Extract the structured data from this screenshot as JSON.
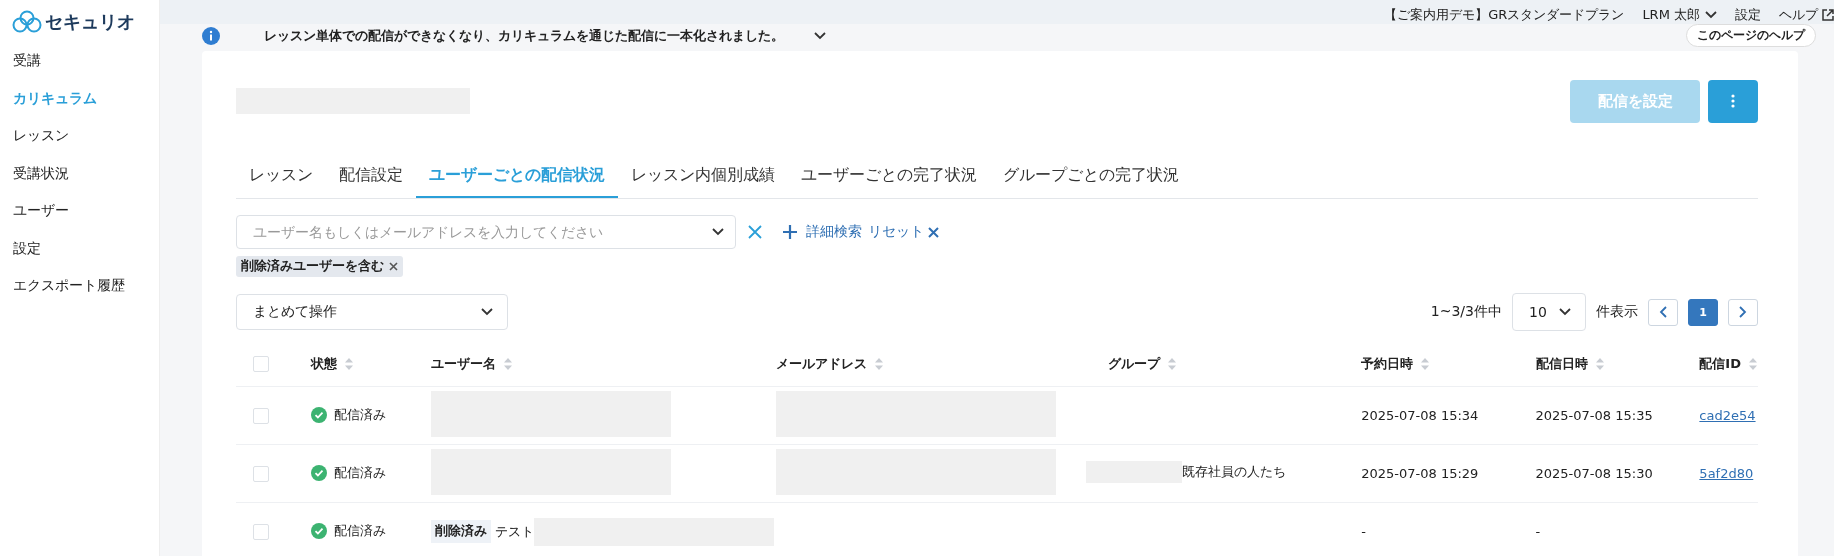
{
  "sidebar": {
    "logo": "セキュリオ",
    "items": [
      {
        "label": "受講",
        "selected": false
      },
      {
        "label": "カリキュラム",
        "selected": true
      },
      {
        "label": "レッスン",
        "selected": false
      },
      {
        "label": "受講状況",
        "selected": false
      },
      {
        "label": "ユーザー",
        "selected": false
      },
      {
        "label": "設定",
        "selected": false
      },
      {
        "label": "エクスポート履歴",
        "selected": false
      }
    ]
  },
  "top_bar": {
    "plan": "【ご案内用デモ】GRスタンダードプラン",
    "user": "LRM 太郎",
    "links": [
      "設定",
      "ヘルプ"
    ]
  },
  "notice": {
    "text": "レッスン単体での配信ができなくなり、カリキュラムを通じた配信に一本化されました。",
    "page_help": "このページのヘルプ"
  },
  "header": {
    "title": {
      "redacted": true
    },
    "primary_button": {
      "label": "配信を設定",
      "disabled": true
    }
  },
  "tabs": [
    {
      "label": "レッスン",
      "selected": false
    },
    {
      "label": "配信設定",
      "selected": false
    },
    {
      "label": "ユーザーごとの配信状況",
      "selected": true
    },
    {
      "label": "レッスン内個別成績",
      "selected": false
    },
    {
      "label": "ユーザーごとの完了状況",
      "selected": false
    },
    {
      "label": "グループごとの完了状況",
      "selected": false
    }
  ],
  "filter": {
    "placeholder": "ユーザー名もしくはメールアドレスを入力してください",
    "advanced_search": "詳細検索",
    "reset": "リセット",
    "tags": [
      "削除済みユーザーを含む"
    ]
  },
  "bulk_action": {
    "label": "まとめて操作"
  },
  "pagination": {
    "summary": "1~3/3件中",
    "per_page": "10",
    "per_page_suffix": "件表示",
    "pages": [
      {
        "label": "1",
        "selected": true
      }
    ]
  },
  "table": {
    "all_checked": false,
    "columns": [
      "状態",
      "ユーザー名",
      "メールアドレス",
      "グループ",
      "予約日時",
      "配信日時",
      "配信ID"
    ],
    "rows": [
      {
        "checked": false,
        "status": "配信済み",
        "user": {
          "redacted": true
        },
        "email": {
          "redacted": true
        },
        "group": {},
        "reserved": "2025-07-08 15:34",
        "delivered": "2025-07-08 15:35",
        "id": "cad2e54"
      },
      {
        "checked": false,
        "status": "配信済み",
        "user": {
          "redacted": true
        },
        "email": {
          "redacted": true
        },
        "group": {
          "redacted": true,
          "text": "既存社員の人たち"
        },
        "reserved": "2025-07-08 15:29",
        "delivered": "2025-07-08 15:30",
        "id": "5af2d80"
      },
      {
        "checked": false,
        "status": "配信済み",
        "user": {
          "badge": "削除済み",
          "text": "テスト",
          "redacted": true
        },
        "email": {},
        "group": {},
        "reserved": "-",
        "delivered": "-"
      }
    ]
  }
}
